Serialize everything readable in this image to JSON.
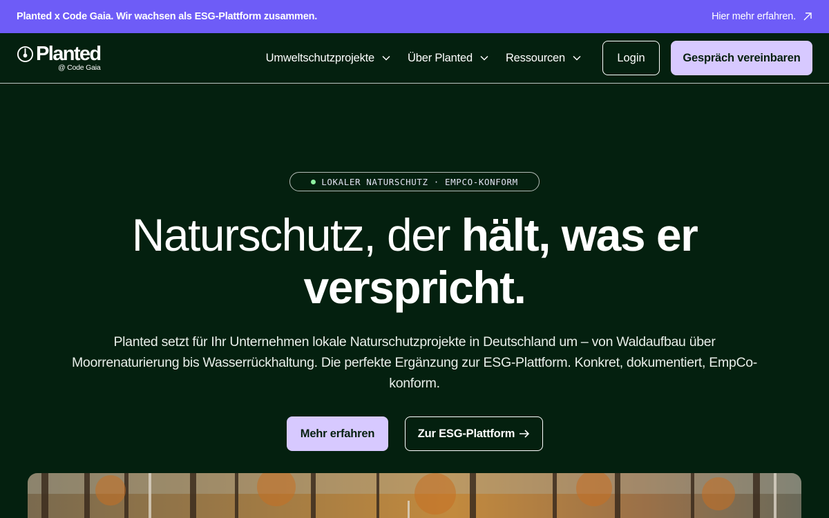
{
  "announcement": {
    "text": "Planted x Code Gaia. Wir wachsen als ESG-Plattform zusammen.",
    "link": "Hier mehr erfahren."
  },
  "nav": {
    "logo_text": "Planted",
    "logo_sub": "@ Code Gaia",
    "items": [
      {
        "label": "Umweltschutzprojekte"
      },
      {
        "label": "Über Planted"
      },
      {
        "label": "Ressourcen"
      }
    ],
    "login": "Login",
    "cta": "Gespräch vereinbaren"
  },
  "hero": {
    "badge": "LOKALER NATURSCHUTZ · EMPCO-KONFORM",
    "headline_light": "Naturschutz, der ",
    "headline_bold_1": "hält, was er",
    "headline_bold_2": "verspricht.",
    "description": "Planted setzt für Ihr Unternehmen lokale Naturschutzprojekte in Deutschland um – von Waldaufbau über Moorrenaturierung bis Wasserrückhaltung. Die perfekte Ergänzung zur ESG-Plattform. Konkret, dokumentiert, EmpCo-konform.",
    "cta_primary": "Mehr erfahren",
    "cta_secondary": "Zur ESG-Plattform"
  },
  "colors": {
    "background": "#04200f",
    "announcement_bg": "#6e5cf7",
    "accent_lavender": "#d7c9ff",
    "badge_dot": "#8df0a0"
  },
  "icons": [
    "arrow-up-right-icon",
    "chevron-down-icon",
    "arrow-right-icon",
    "planted-logo-icon"
  ]
}
